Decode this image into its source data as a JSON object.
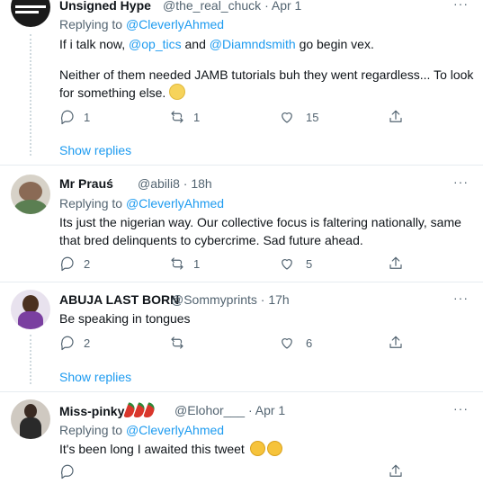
{
  "tweets": [
    {
      "name": "Unsigned Hype",
      "handle": "@the_real_chuck",
      "sep": "·",
      "time": "Apr 1",
      "replying_prefix": "Replying to",
      "replying_to": "@CleverlyAhmed",
      "line1_pre": "If i talk now,",
      "mention1": "@op_tics",
      "and": "and",
      "mention2": "@Diamndsmith",
      "line1_post": "go begin vex.",
      "line2": "Neither of them needed JAMB tutorials buh they went regardless... To look",
      "line3": "for something else.",
      "emoji": "slight-frown-emoji",
      "replies": "1",
      "retweets": "1",
      "likes": "15",
      "show_replies": "Show replies"
    },
    {
      "name": "Mr Prauś",
      "handle": "@abili8",
      "sep": "·",
      "time": "18h",
      "replying_prefix": "Replying to",
      "replying_to": "@CleverlyAhmed",
      "line1": "Its just the nigerian way. Our collective focus is faltering nationally, same",
      "line2": "that bred delinquents to cybercrime. Sad future ahead.",
      "replies": "2",
      "retweets": "1",
      "likes": "5"
    },
    {
      "name": "ABUJA LAST BORN",
      "handle": "@Sommyprints",
      "sep": "·",
      "time": "17h",
      "line1": "Be speaking in tongues",
      "replies": "2",
      "retweets": "",
      "likes": "6",
      "show_replies": "Show replies"
    },
    {
      "name": "Miss-pinky",
      "handle": "@Elohor___",
      "sep": "·",
      "time": "Apr 1",
      "replying_prefix": "Replying to",
      "replying_to": "@CleverlyAhmed",
      "line1": "It's been long I awaited this tweet",
      "emoji": "tears-of-joy-emoji"
    }
  ],
  "more_label": "···"
}
